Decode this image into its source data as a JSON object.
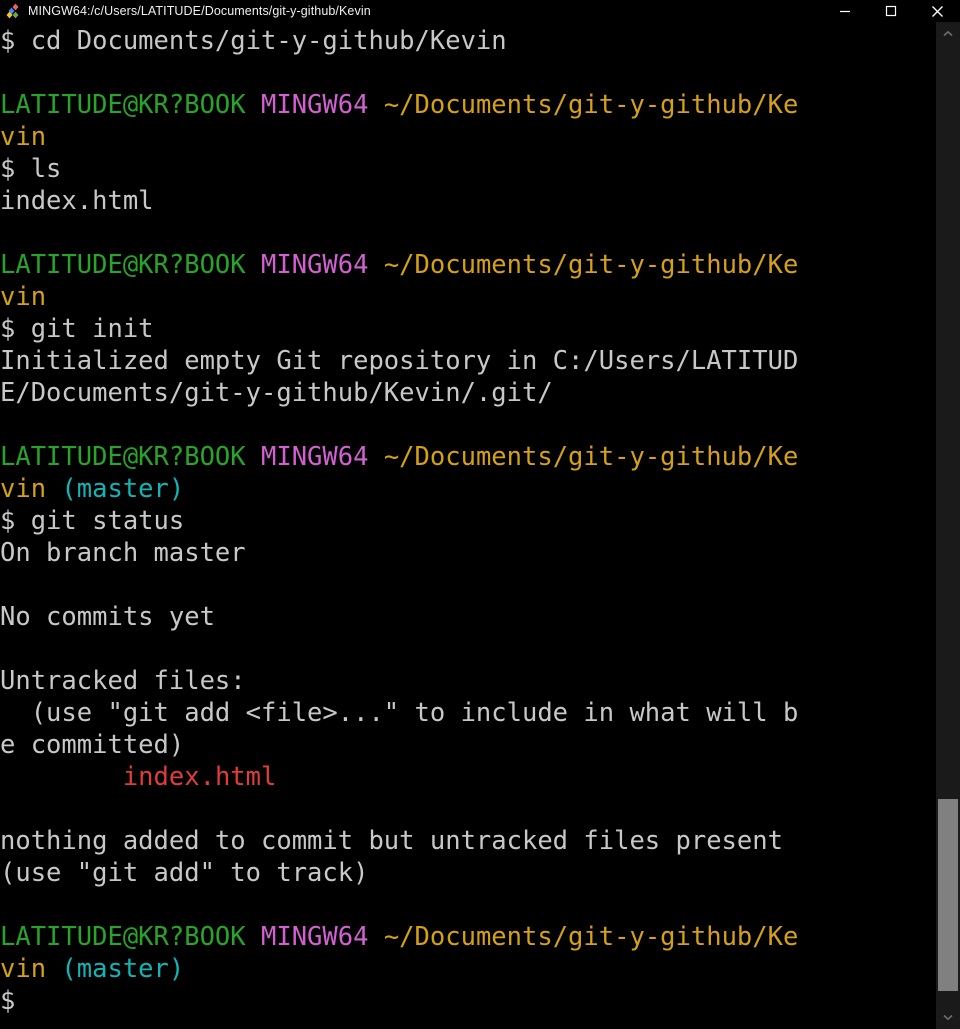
{
  "window": {
    "title": "MINGW64:/c/Users/LATITUDE/Documents/git-y-github/Kevin",
    "icon": "git-bash-diamond-icon",
    "background_color": "#000000",
    "controls": {
      "minimize_label": "—",
      "maximize_label": "□",
      "close_label": "✕"
    }
  },
  "colors": {
    "default_text": "#c8c8c8",
    "green": "#29a329",
    "magenta": "#d161d1",
    "yellow": "#d4a017",
    "cyan": "#11b5b5",
    "red": "#e03c3c",
    "background": "#000000",
    "scrollbar_track": "#1a1a1a",
    "scrollbar_thumb": "#808080"
  },
  "terminal": {
    "columns": 48,
    "prompt_user_host": "LATITUDE@KR?BOOK",
    "prompt_shell": "MINGW64",
    "prompt_path": "~/Documents/git-y-github/Kevin",
    "prompt_branch": "(master)",
    "prompt_symbol": "$",
    "lines": [
      {
        "segments": [
          {
            "text": "$ cd Documents/git-y-github/Kevin",
            "color": "default"
          }
        ]
      },
      {
        "segments": [
          {
            "text": "",
            "color": "default"
          }
        ]
      },
      {
        "segments": [
          {
            "text": "LATITUDE@KR?BOOK",
            "color": "green"
          },
          {
            "text": " ",
            "color": "default"
          },
          {
            "text": "MINGW64",
            "color": "magenta"
          },
          {
            "text": " ",
            "color": "default"
          },
          {
            "text": "~/Documents/git-y-github/Ke",
            "color": "yellow"
          }
        ]
      },
      {
        "segments": [
          {
            "text": "vin",
            "color": "yellow"
          }
        ]
      },
      {
        "segments": [
          {
            "text": "$ ls",
            "color": "default"
          }
        ]
      },
      {
        "segments": [
          {
            "text": "index.html",
            "color": "default"
          }
        ]
      },
      {
        "segments": [
          {
            "text": "",
            "color": "default"
          }
        ]
      },
      {
        "segments": [
          {
            "text": "LATITUDE@KR?BOOK",
            "color": "green"
          },
          {
            "text": " ",
            "color": "default"
          },
          {
            "text": "MINGW64",
            "color": "magenta"
          },
          {
            "text": " ",
            "color": "default"
          },
          {
            "text": "~/Documents/git-y-github/Ke",
            "color": "yellow"
          }
        ]
      },
      {
        "segments": [
          {
            "text": "vin",
            "color": "yellow"
          }
        ]
      },
      {
        "segments": [
          {
            "text": "$ git init",
            "color": "default"
          }
        ]
      },
      {
        "segments": [
          {
            "text": "Initialized empty Git repository in C:/Users/LATITUD",
            "color": "default"
          }
        ]
      },
      {
        "segments": [
          {
            "text": "E/Documents/git-y-github/Kevin/.git/",
            "color": "default"
          }
        ]
      },
      {
        "segments": [
          {
            "text": "",
            "color": "default"
          }
        ]
      },
      {
        "segments": [
          {
            "text": "LATITUDE@KR?BOOK",
            "color": "green"
          },
          {
            "text": " ",
            "color": "default"
          },
          {
            "text": "MINGW64",
            "color": "magenta"
          },
          {
            "text": " ",
            "color": "default"
          },
          {
            "text": "~/Documents/git-y-github/Ke",
            "color": "yellow"
          }
        ]
      },
      {
        "segments": [
          {
            "text": "vin",
            "color": "yellow"
          },
          {
            "text": " ",
            "color": "default"
          },
          {
            "text": "(master)",
            "color": "cyan"
          }
        ]
      },
      {
        "segments": [
          {
            "text": "$ git status",
            "color": "default"
          }
        ]
      },
      {
        "segments": [
          {
            "text": "On branch master",
            "color": "default"
          }
        ]
      },
      {
        "segments": [
          {
            "text": "",
            "color": "default"
          }
        ]
      },
      {
        "segments": [
          {
            "text": "No commits yet",
            "color": "default"
          }
        ]
      },
      {
        "segments": [
          {
            "text": "",
            "color": "default"
          }
        ]
      },
      {
        "segments": [
          {
            "text": "Untracked files:",
            "color": "default"
          }
        ]
      },
      {
        "segments": [
          {
            "text": "  (use \"git add <file>...\" to include in what will b",
            "color": "default"
          }
        ]
      },
      {
        "segments": [
          {
            "text": "e committed)",
            "color": "default"
          }
        ]
      },
      {
        "segments": [
          {
            "text": "        ",
            "color": "default"
          },
          {
            "text": "index.html",
            "color": "red"
          }
        ]
      },
      {
        "segments": [
          {
            "text": "",
            "color": "default"
          }
        ]
      },
      {
        "segments": [
          {
            "text": "nothing added to commit but untracked files present",
            "color": "default"
          }
        ]
      },
      {
        "segments": [
          {
            "text": "(use \"git add\" to track)",
            "color": "default"
          }
        ]
      },
      {
        "segments": [
          {
            "text": "",
            "color": "default"
          }
        ]
      },
      {
        "segments": [
          {
            "text": "LATITUDE@KR?BOOK",
            "color": "green"
          },
          {
            "text": " ",
            "color": "default"
          },
          {
            "text": "MINGW64",
            "color": "magenta"
          },
          {
            "text": " ",
            "color": "default"
          },
          {
            "text": "~/Documents/git-y-github/Ke",
            "color": "yellow"
          }
        ]
      },
      {
        "segments": [
          {
            "text": "vin",
            "color": "yellow"
          },
          {
            "text": " ",
            "color": "default"
          },
          {
            "text": "(master)",
            "color": "cyan"
          }
        ]
      },
      {
        "segments": [
          {
            "text": "$ ",
            "color": "default"
          }
        ]
      }
    ]
  },
  "scrollbar": {
    "up_arrow": "chevron-up-icon",
    "down_arrow": "chevron-down-icon",
    "thumb_top_pct": 78.5,
    "thumb_height_pct": 20.0
  }
}
